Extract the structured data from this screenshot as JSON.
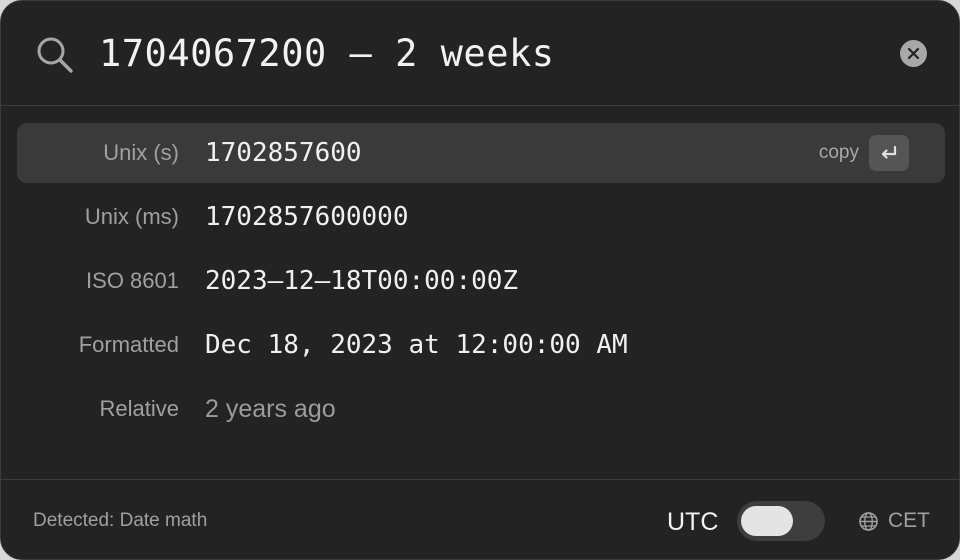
{
  "search": {
    "query": "1704067200 – 2 weeks",
    "icon": "search-icon",
    "clear_icon": "close-icon"
  },
  "results": [
    {
      "label": "Unix (s)",
      "value": "1702857600",
      "selected": true,
      "copy_hint": "copy",
      "key_icon": "return-icon"
    },
    {
      "label": "Unix (ms)",
      "value": "1702857600000",
      "selected": false
    },
    {
      "label": "ISO 8601",
      "value": "2023–12–18T00:00:00Z",
      "selected": false
    },
    {
      "label": "Formatted",
      "value": "Dec 18, 2023 at 12:00:00 AM",
      "selected": false
    },
    {
      "label": "Relative",
      "value": "2 years ago",
      "selected": false
    }
  ],
  "footer": {
    "detected": "Detected: Date math",
    "utc_label": "UTC",
    "utc_enabled": false,
    "timezone": "CET",
    "timezone_icon": "globe-icon"
  },
  "colors": {
    "background": "#232323",
    "selected_row": "#3a3a3a",
    "text_primary": "#f0f0f0",
    "text_secondary": "#a0a0a0"
  }
}
